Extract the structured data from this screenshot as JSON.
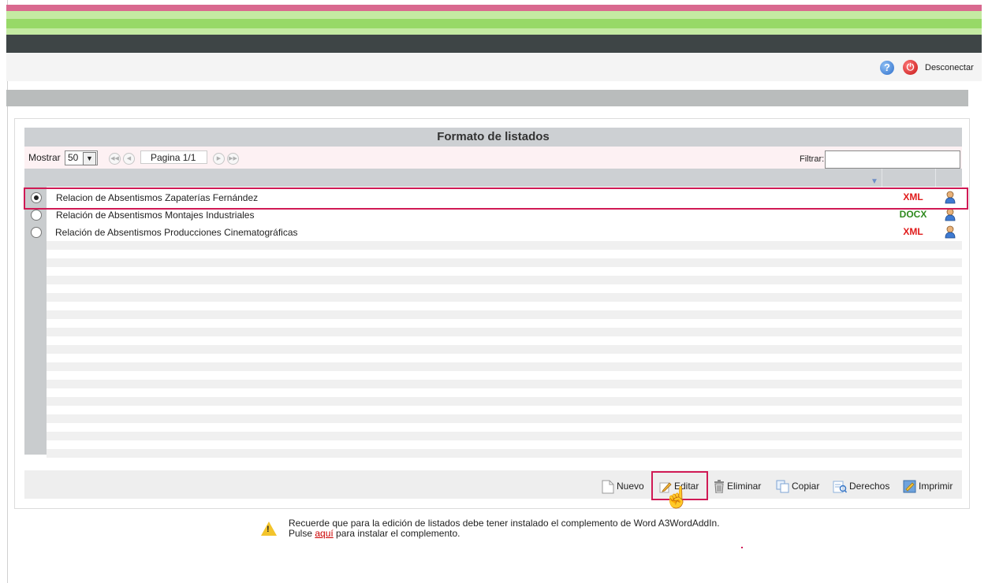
{
  "header": {
    "logout_label": "Desconectar",
    "help_icon": "help-icon",
    "power_icon": "power-icon"
  },
  "panel": {
    "title": "Formato de listados",
    "show_label": "Mostrar",
    "page_size": "50",
    "page_label": "Pagina 1/1",
    "filter_label": "Filtrar:",
    "filter_value": ""
  },
  "rows": [
    {
      "name": "Relacion de Absentismos Zapaterías Fernández",
      "format": "XML",
      "format_color": "#e01b1b",
      "selected": true
    },
    {
      "name": "Relación de Absentismos Montajes  Industriales",
      "format": "DOCX",
      "format_color": "#2f8a1f",
      "selected": false
    },
    {
      "name": "Relación de Absentismos Producciones Cinematográficas",
      "format": "XML",
      "format_color": "#e01b1b",
      "selected": false
    }
  ],
  "actions": {
    "new": "Nuevo",
    "edit": "Editar",
    "delete": "Eliminar",
    "copy": "Copiar",
    "rights": "Derechos",
    "print": "Imprimir"
  },
  "notice": {
    "line1": "Recuerde que para la edición de listados debe tener instalado el complemento de Word A3WordAddIn.",
    "line2_before": "Pulse ",
    "line2_link": "aquí",
    "line2_after": " para instalar el complemento."
  },
  "colors": {
    "highlight": "#d01a55",
    "xml": "#e01b1b",
    "docx": "#2f8a1f"
  }
}
